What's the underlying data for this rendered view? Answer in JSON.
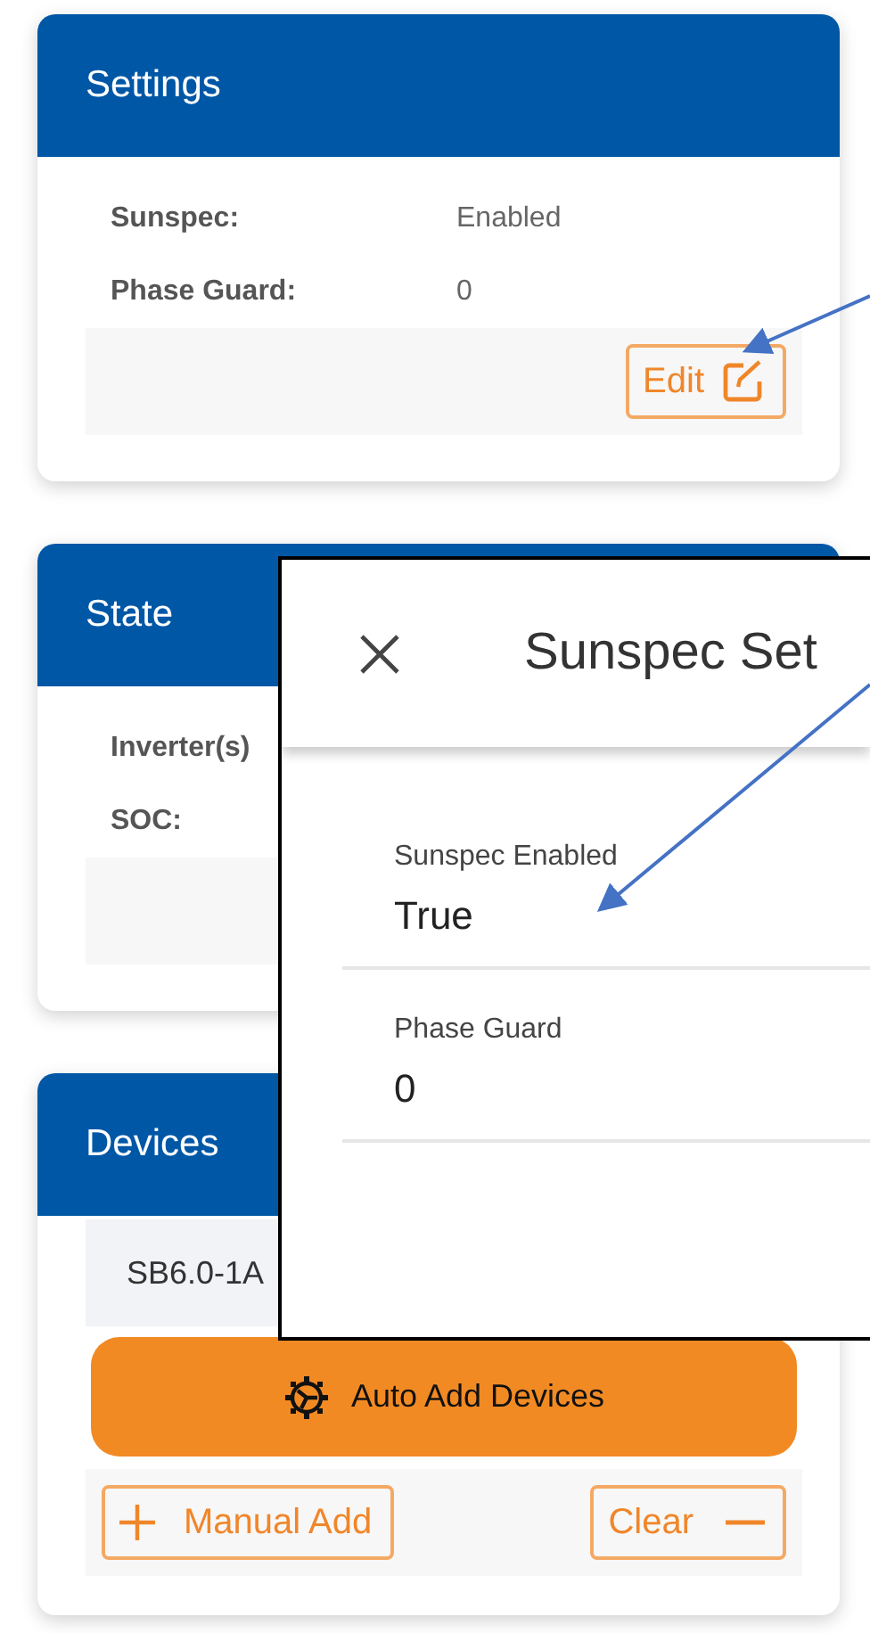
{
  "settings": {
    "title": "Settings",
    "rows": [
      {
        "label": "Sunspec:",
        "value": "Enabled"
      },
      {
        "label": "Phase Guard:",
        "value": "0"
      }
    ],
    "edit_button": "Edit"
  },
  "state": {
    "title": "State",
    "rows": [
      {
        "label": "Inverter(s)"
      },
      {
        "label": "SOC:"
      }
    ]
  },
  "devices": {
    "title": "Devices",
    "items": [
      "SB6.0-1A"
    ],
    "auto_add_button": "Auto Add Devices",
    "manual_add_button": "Manual Add",
    "clear_button": "Clear"
  },
  "dialog": {
    "title": "Sunspec Set",
    "fields": [
      {
        "label": "Sunspec Enabled",
        "value": "True"
      },
      {
        "label": "Phase Guard",
        "value": "0"
      }
    ]
  }
}
